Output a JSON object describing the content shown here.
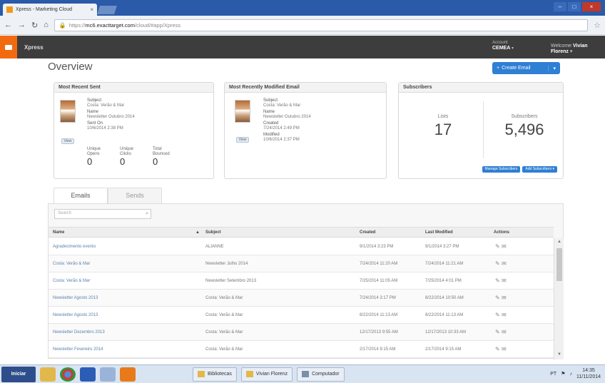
{
  "browser": {
    "tab_title": "Xpress - Marketing Cloud",
    "tab_close": "×",
    "url_prefix": "https://",
    "url_domain": "mc6.exacttarget.com",
    "url_path": "/cloud/#app/Xpress"
  },
  "app": {
    "name": "Xpress",
    "account_label": "Account",
    "account_name": "CEMEA",
    "welcome": "Welcome",
    "user_name": "Vivian Florenz"
  },
  "page": {
    "title": "Overview",
    "create_button": "Create Email"
  },
  "recent_sent": {
    "header": "Most Recent Sent",
    "view_label": "View",
    "subject_label": "Subject",
    "subject": "Costa: Verão & Mar",
    "name_label": "Name",
    "name": "Newsletter Outubro 2014",
    "sent_label": "Sent On",
    "sent_on": "10/6/2014 2:38 PM",
    "unique_opens_label": "Unique Opens",
    "unique_opens": "0",
    "unique_clicks_label": "Unique Clicks",
    "unique_clicks": "0",
    "total_bounced_label": "Total Bounced",
    "total_bounced": "0"
  },
  "recent_modified": {
    "header": "Most Recently Modified Email",
    "view_label": "View",
    "subject_label": "Subject",
    "subject": "Costa: Verão & Mar",
    "name_label": "Name",
    "name": "Newsletter Outubro 2014",
    "created_label": "Created",
    "created": "7/24/2014 2:49 PM",
    "modified_label": "Modified",
    "modified": "10/6/2014 2:37 PM"
  },
  "subscribers": {
    "header": "Subscribers",
    "lists_label": "Lists",
    "lists_count": "17",
    "subscribers_label": "Subscribers",
    "subscribers_count": "5,496",
    "manage_button": "Manage Subscribers",
    "add_button": "Add Subscribers"
  },
  "tabs": [
    "Emails",
    "Sends"
  ],
  "search_placeholder": "Search",
  "table": {
    "headers": [
      "Name",
      "Subject",
      "Created",
      "Last Modified",
      "Actions"
    ],
    "rows": [
      {
        "name": "Agradecimento evento",
        "subject": "ALIANNE",
        "created": "9/1/2014 3:23 PM",
        "modified": "9/1/2014 3:27 PM"
      },
      {
        "name": "Costa: Verão & Mar",
        "subject": "Newsletter Julho 2014",
        "created": "7/24/2014 11:20 AM",
        "modified": "7/24/2014 11:21 AM"
      },
      {
        "name": "Costa: Verão & Mar",
        "subject": "Newsletter Setembro 2013",
        "created": "7/25/2014 11:05 AM",
        "modified": "7/25/2014 4:01 PM"
      },
      {
        "name": "Newsletter Agosto 2013",
        "subject": "Costa: Verão & Mar",
        "created": "7/24/2014 3:17 PM",
        "modified": "8/22/2014 10:50 AM"
      },
      {
        "name": "Newsletter Agosto 2013",
        "subject": "Costa: Verão & Mar",
        "created": "8/22/2014 11:13 AM",
        "modified": "8/22/2014 11:13 AM"
      },
      {
        "name": "Newsletter Dezembro 2013",
        "subject": "Costa: Verão & Mar",
        "created": "12/17/2013 9:55 AM",
        "modified": "12/17/2013 10:33 AM"
      },
      {
        "name": "Newsletter Fevereiro 2014",
        "subject": "Costa: Verão & Mar",
        "created": "2/17/2014 9:15 AM",
        "modified": "2/17/2014 9:15 AM"
      }
    ]
  },
  "taskbar": {
    "start": "Iniciar",
    "task1": "Bibliotecas",
    "task2": "Vivian Florenz",
    "task3": "Computador",
    "lang": "PT",
    "time": "14:35",
    "date": "11/11/2014"
  },
  "colors": {
    "accent_blue": "#2f7fd4",
    "brand_orange": "#f26a10",
    "header_dark": "#3d3d3d"
  }
}
